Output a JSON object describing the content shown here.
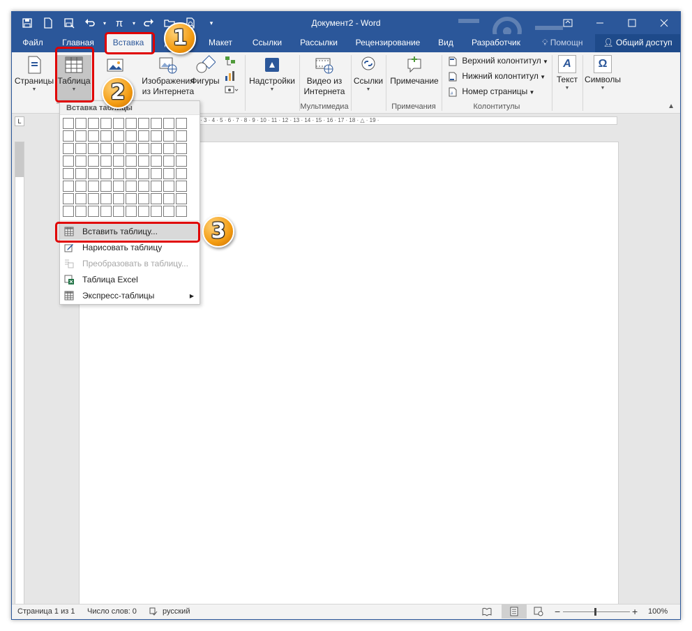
{
  "window": {
    "title": "Документ2 - Word"
  },
  "qat": {
    "pi_symbol": "π"
  },
  "tabs": [
    {
      "label": "Файл",
      "active": false
    },
    {
      "label": "Главная",
      "active": false
    },
    {
      "label": "Вставка",
      "active": true
    },
    {
      "label": "Д",
      "active": false
    },
    {
      "label": "Макет",
      "active": false
    },
    {
      "label": "Ссылки",
      "active": false
    },
    {
      "label": "Рассылки",
      "active": false
    },
    {
      "label": "Рецензирование",
      "active": false
    },
    {
      "label": "Вид",
      "active": false
    },
    {
      "label": "Разработчик",
      "active": false
    }
  ],
  "tell_me": "Помощн",
  "share": "Общий доступ",
  "ribbon": {
    "pages": "Страницы",
    "table": "Таблица",
    "pictures": "Р",
    "online_pictures_1": "Изображения",
    "online_pictures_2": "из Интернета",
    "shapes": "Фигуры",
    "addins": "Надстройки",
    "video_1": "Видео из",
    "video_2": "Интернета",
    "links": "Ссылки",
    "comment": "Примечание",
    "header": "Верхний колонтитул",
    "footer": "Нижний колонтитул",
    "page_number": "Номер страницы",
    "text": "Текст",
    "symbols": "Символы",
    "symbol_glyph": "Ω",
    "text_glyph": "A",
    "group_media": "Мультимедиа",
    "group_comments": "Примечания",
    "group_headers": "Колонтитулы"
  },
  "ruler": {
    "h": "· 1 · 2 · 3 · 4 · 5 · 6 · 7 · 8 · 9 · 10 · 11 · 12 · 13 · 14 · 15 · 16 · 17 · 18 · △ · 19 ·",
    "corner": "L"
  },
  "dropdown": {
    "header": "Вставка таблицы",
    "grid_columns": 10,
    "grid_rows": 8,
    "items": [
      {
        "label": "Вставить таблицу...",
        "disabled": false,
        "hover": true
      },
      {
        "label": "Нарисовать таблицу",
        "disabled": false
      },
      {
        "label": "Преобразовать в таблицу...",
        "disabled": true
      },
      {
        "label": "Таблица Excel",
        "disabled": false
      },
      {
        "label": "Экспресс-таблицы",
        "disabled": false,
        "submenu": true
      }
    ]
  },
  "callouts": [
    "1",
    "2",
    "3"
  ],
  "status": {
    "page": "Страница 1 из 1",
    "words": "Число слов: 0",
    "language": "русский",
    "zoom": "100%",
    "minus": "−",
    "plus": "+"
  }
}
